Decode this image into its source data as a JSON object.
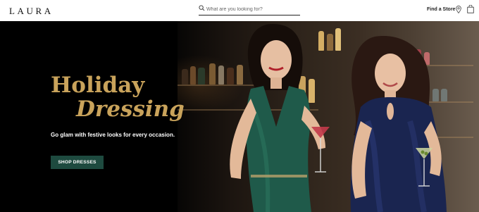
{
  "header": {
    "logo": "LAURA",
    "search_placeholder": "What are you looking for?",
    "find_store_label": "Find a Store",
    "icons": [
      "search-icon",
      "location-pin-icon",
      "shopping-bag-icon"
    ]
  },
  "hero": {
    "headline_line1": "Holiday",
    "headline_line2": "Dressing",
    "tagline": "Go glam with festive looks for every occasion.",
    "cta_label": "SHOP DRESSES",
    "colors": {
      "headline": "#c9a35b",
      "cta_background": "#1e4a3f",
      "background": "#000000",
      "green_dress": "#1f5a4a",
      "blue_dress": "#1a2550"
    }
  }
}
